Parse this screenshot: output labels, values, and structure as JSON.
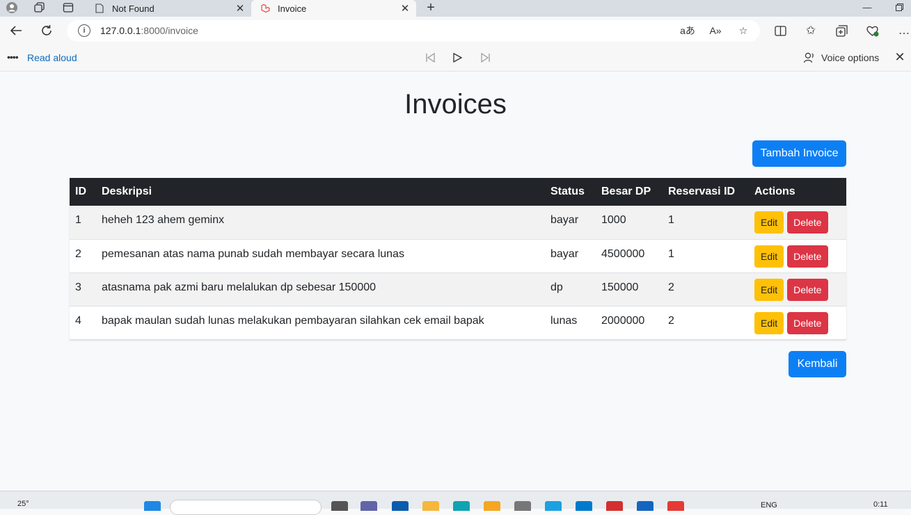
{
  "browser": {
    "tabs": [
      {
        "title": "Not Found",
        "active": false
      },
      {
        "title": "Invoice",
        "active": true
      }
    ],
    "address": {
      "host": "127.0.0.1",
      "path": ":8000/invoice"
    },
    "read_aloud": {
      "label": "Read aloud",
      "voice_options": "Voice options"
    }
  },
  "page": {
    "title": "Invoices",
    "add_button": "Tambah Invoice",
    "back_button": "Kembali",
    "table": {
      "headers": [
        "ID",
        "Deskripsi",
        "Status",
        "Besar DP",
        "Reservasi ID",
        "Actions"
      ],
      "rows": [
        {
          "id": "1",
          "deskripsi": "heheh 123 ahem geminx",
          "status": "bayar",
          "besar_dp": "1000",
          "reservasi_id": "1"
        },
        {
          "id": "2",
          "deskripsi": "pemesanan atas nama punab sudah membayar secara lunas",
          "status": "bayar",
          "besar_dp": "4500000",
          "reservasi_id": "1"
        },
        {
          "id": "3",
          "deskripsi": "atasnama pak azmi baru melalukan dp sebesar 150000",
          "status": "dp",
          "besar_dp": "150000",
          "reservasi_id": "2"
        },
        {
          "id": "4",
          "deskripsi": "bapak maulan sudah lunas melakukan pembayaran silahkan cek email bapak",
          "status": "lunas",
          "besar_dp": "2000000",
          "reservasi_id": "2"
        }
      ],
      "edit_label": "Edit",
      "delete_label": "Delete"
    }
  },
  "taskbar": {
    "weather": "25°",
    "language": "ENG",
    "clock": "0:11"
  },
  "colors": {
    "primary": "#0d7ff5",
    "warning": "#ffc107",
    "danger": "#dc3545",
    "table_head": "#212529"
  }
}
